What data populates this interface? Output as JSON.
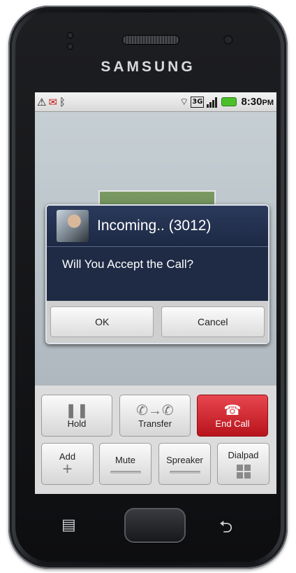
{
  "device": {
    "brand": "SAMSUNG"
  },
  "statusbar": {
    "left_icons": [
      "warning-icon",
      "missed-call-icon",
      "bluetooth-icon"
    ],
    "right_icons": [
      "wifi-icon",
      "3g-icon",
      "signal-icon",
      "battery-icon"
    ],
    "time": "8:30",
    "ampm": "PM"
  },
  "dialog": {
    "title": "Incoming.. (3012)",
    "message": "Will You Accept the Call?",
    "ok_label": "OK",
    "cancel_label": "Cancel"
  },
  "controls": {
    "hold": "Hold",
    "transfer": "Transfer",
    "end_call": "End Call",
    "add": "Add",
    "mute": "Mute",
    "speaker": "Spreaker",
    "dialpad": "Dialpad"
  },
  "colors": {
    "dialog_bg": "#1f2b45",
    "end_call_red": "#d0232c",
    "battery_green": "#4cc02b"
  }
}
